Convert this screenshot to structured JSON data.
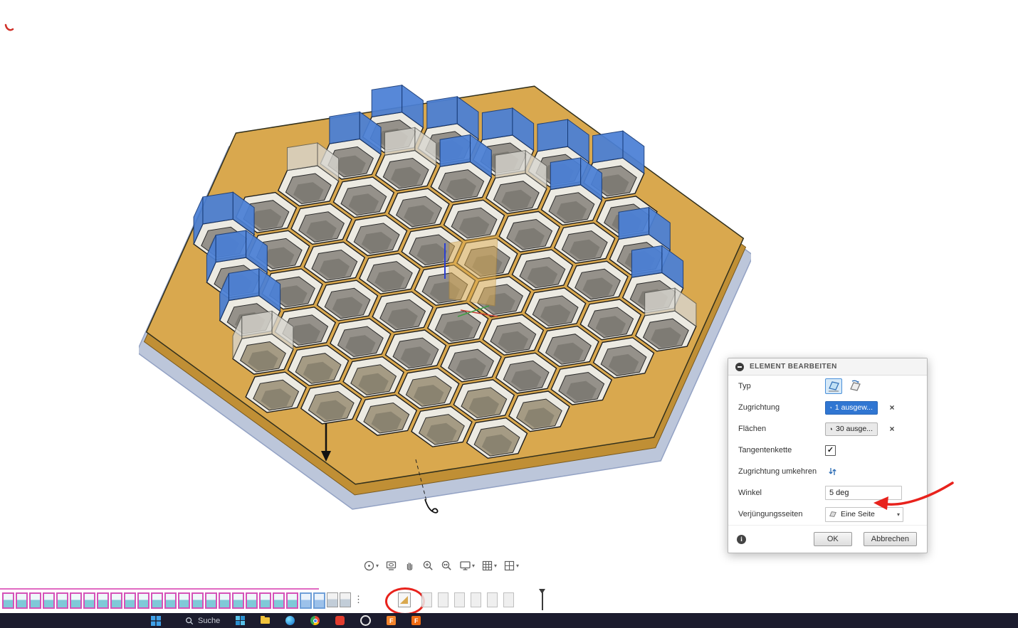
{
  "colors": {
    "gold": "#d9a84e",
    "gold_dark": "#c08f35",
    "plate": "#bcc6da",
    "plate_edge": "#93a2c4",
    "rim": "#eceae2",
    "rim_edge": "#1d1d1d",
    "hole": "#95918a",
    "hole_warm": "#a59b84",
    "hole_edge": "#2b2b2b",
    "blue_face": "#4b80d6",
    "blue_face_edge": "#163a78",
    "gray_wall": "#d8d6cf",
    "accent_blue": "#3076d2",
    "annotation_red": "#e8221c",
    "timeline_pink": "#d553b8"
  },
  "dialog": {
    "title": "ELEMENT BEARBEITEN",
    "type_label": "Typ",
    "pull_direction_label": "Zugrichtung",
    "pull_direction_value": "1 ausgew...",
    "faces_label": "Flächen",
    "faces_value": "30 ausge...",
    "tangent_chain_label": "Tangentenkette",
    "tangent_chain_checked": "checked",
    "flip_label": "Zugrichtung umkehren",
    "angle_label": "Winkel",
    "angle_value": "5 deg",
    "taper_sides_label": "Verjüngungsseiten",
    "taper_sides_value": "Eine Seite",
    "ok_label": "OK",
    "cancel_label": "Abbrechen"
  },
  "view_toolbar": {
    "icons": [
      "orbit",
      "look-at",
      "pan",
      "zoom",
      "fit-to-view",
      "display-settings",
      "grid-settings",
      "viewports"
    ]
  },
  "timeline": {
    "items": [
      "pink",
      "pink",
      "pink",
      "pink",
      "pink",
      "pink",
      "pink",
      "pink",
      "pink",
      "pink",
      "pink",
      "pink",
      "pink",
      "pink",
      "pink",
      "pink",
      "pink",
      "pink",
      "pink",
      "pink",
      "pink",
      "pink",
      "blue",
      "blue",
      "bluegray",
      "bluegray",
      "dots",
      "draft",
      "gray",
      "gray",
      "gray",
      "gray",
      "gray",
      "gray"
    ]
  },
  "taskbar": {
    "search_label": "Suche"
  }
}
